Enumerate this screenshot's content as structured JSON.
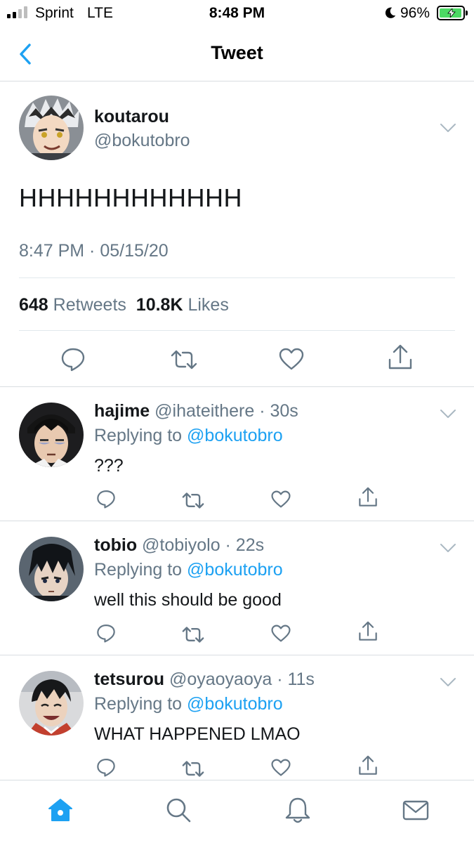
{
  "status_bar": {
    "carrier": "Sprint",
    "network": "LTE",
    "time": "8:48 PM",
    "battery": "96%",
    "battery_level": 0.96,
    "signal_bars": 2,
    "icons": [
      "signal-icon",
      "moon-icon",
      "battery-charging-icon"
    ]
  },
  "nav": {
    "title": "Tweet",
    "back_icon": "chevron-left-icon"
  },
  "tweet": {
    "display_name": "koutarou",
    "handle": "@bokutobro",
    "text": "HHHHHHHHHHHH",
    "timestamp": "8:47 PM · 05/15/20",
    "retweets_count": "648",
    "retweets_label": "Retweets",
    "likes_count": "10.8K",
    "likes_label": "Likes",
    "actions": [
      "reply-icon",
      "retweet-icon",
      "like-icon",
      "share-icon"
    ]
  },
  "replies": [
    {
      "display_name": "hajime",
      "meta": "@ihateithere · 30s",
      "replying_label": "Replying to",
      "replying_to": "@bokutobro",
      "text": "???"
    },
    {
      "display_name": "tobio",
      "meta": "@tobiyolo · 22s",
      "replying_label": "Replying to",
      "replying_to": "@bokutobro",
      "text": "well this should be good"
    },
    {
      "display_name": "tetsurou",
      "meta": "@oyaoyaoya · 11s",
      "replying_label": "Replying to",
      "replying_to": "@bokutobro",
      "text": "WHAT HAPPENED LMAO"
    }
  ],
  "tab_bar": {
    "items": [
      "home-icon",
      "search-icon",
      "notifications-icon",
      "messages-icon"
    ],
    "active": "home-icon"
  },
  "colors": {
    "accent": "#1da1f2",
    "muted": "#657786",
    "text": "#14171a",
    "border": "#d8dde1",
    "icon": "#657786"
  }
}
